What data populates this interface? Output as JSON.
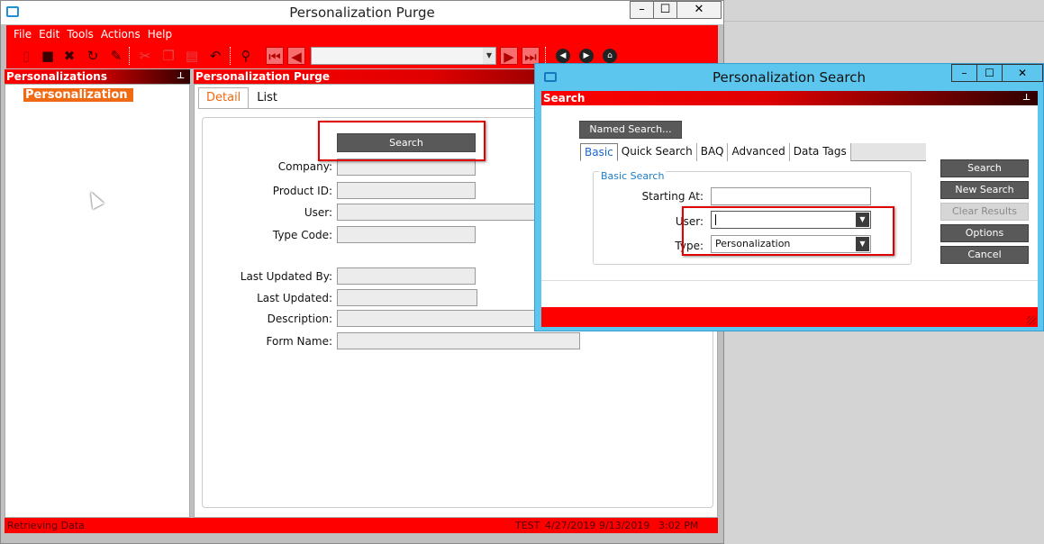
{
  "main_window": {
    "title": "Personalization Purge",
    "controls": {
      "minimize": "–",
      "maximize": "☐",
      "close": "✕"
    }
  },
  "menu": [
    "File",
    "Edit",
    "Tools",
    "Actions",
    "Help"
  ],
  "toolbar": {
    "icons": [
      "new-icon",
      "save-icon",
      "delete-icon",
      "refresh-icon",
      "clear-icon",
      "cut-icon",
      "copy-icon",
      "paste-icon",
      "undo-icon",
      "binoculars-icon",
      "first-record-icon",
      "previous-record-icon",
      "next-record-icon",
      "last-record-icon",
      "back-icon",
      "forward-icon",
      "home-icon"
    ]
  },
  "left_pane": {
    "header": "Personalizations",
    "tree_item": "Personalization"
  },
  "content_pane": {
    "header": "Personalization Purge",
    "tabs": [
      {
        "label": "Detail",
        "active": true
      },
      {
        "label": "List",
        "active": false
      }
    ],
    "search_button": "Search",
    "fields": {
      "company": "Company:",
      "product_id": "Product ID:",
      "user": "User:",
      "type_code": "Type Code:",
      "last_updated_by": "Last Updated By:",
      "last_updated": "Last Updated:",
      "description": "Description:",
      "form_name": "Form Name:"
    }
  },
  "status_bar": {
    "message": "Retrieving Data",
    "environment": "TEST",
    "date1": "4/27/2019",
    "date2": "9/13/2019",
    "time": "3:02 PM"
  },
  "dialog": {
    "title": "Personalization Search",
    "controls": {
      "minimize": "–",
      "maximize": "☐",
      "close": "✕"
    },
    "header": "Search",
    "named_search_button": "Named Search...",
    "tabs": [
      {
        "label": "Basic",
        "active": true
      },
      {
        "label": "Quick Search",
        "active": false
      },
      {
        "label": "BAQ",
        "active": false
      },
      {
        "label": "Advanced",
        "active": false
      },
      {
        "label": "Data Tags",
        "active": false
      }
    ],
    "group_title": "Basic Search",
    "starting_at_label": "Starting At:",
    "starting_at_value": "",
    "user_label": "User:",
    "user_value": "",
    "type_label": "Type:",
    "type_value": "Personalization",
    "buttons": {
      "search": "Search",
      "new_search": "New Search",
      "clear_results": "Clear Results",
      "options": "Options",
      "cancel": "Cancel"
    }
  },
  "colors": {
    "accent_red": "#ff0000",
    "active_tab_orange": "#f06a14",
    "dialog_frame": "#5cc6ee",
    "dark_button": "#595959",
    "highlight_box": "#e00000"
  }
}
